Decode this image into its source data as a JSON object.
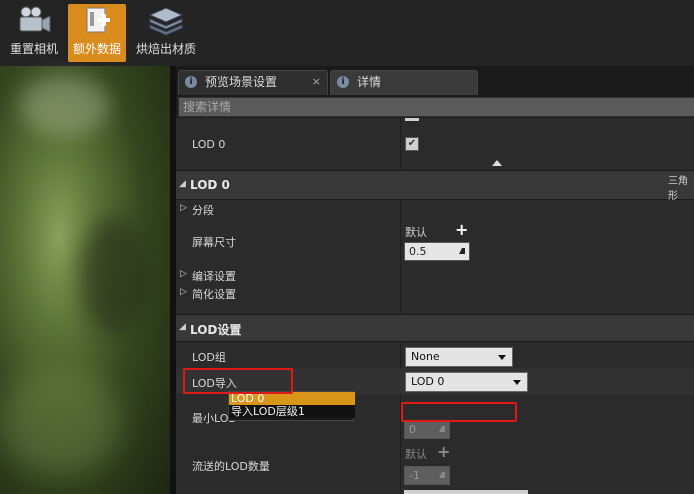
{
  "toolbar": {
    "reset_camera": "重置相机",
    "extra_data": "额外数据",
    "bake_material": "烘焙出材质"
  },
  "tabs": [
    {
      "label": "预览场景设置",
      "close": "×"
    },
    {
      "label": "详情"
    }
  ],
  "search": {
    "placeholder": "搜索详情"
  },
  "details": {
    "lod0_row_label": "LOD 0",
    "lod0_checked": true,
    "section_lod0": "LOD 0",
    "right_truncated": "三角形",
    "segments": "分段",
    "screen_size": "屏幕尺寸",
    "default_label": "默认",
    "screen_size_value": "0.5",
    "build_settings": "编译设置",
    "reduction_settings": "简化设置",
    "section_lod_settings": "LOD设置",
    "lod_group": "LOD组",
    "lod_group_value": "None",
    "lod_import": "LOD导入",
    "lod_import_value": "LOD 0",
    "min_lod": "最小LOD",
    "min_lod_value": "0",
    "streamed_lods": "流送的LOD数量",
    "streamed_default": "默认",
    "streamed_value": "-1"
  },
  "lod_import_options": [
    "LOD 0",
    "导入LOD层级1"
  ],
  "colors": {
    "active_toolbar": "#d98c1d",
    "highlight": "#e01818",
    "selected_option": "#d9961a"
  }
}
